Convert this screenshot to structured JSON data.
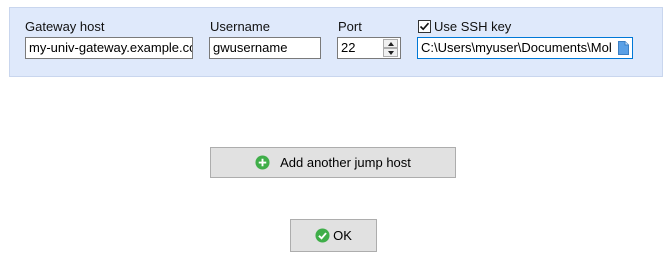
{
  "gateway": {
    "host_label": "Gateway host",
    "host_value": "my-univ-gateway.example.co",
    "username_label": "Username",
    "username_value": "gwusername",
    "port_label": "Port",
    "port_value": "22",
    "ssh_key_label": "Use SSH key",
    "ssh_key_checked": true,
    "ssh_key_path": "C:\\Users\\myuser\\Documents\\Mol"
  },
  "actions": {
    "add_jump_host_label": "Add another jump host",
    "ok_label": "OK"
  },
  "icons": {
    "add": "plus-circle-icon",
    "ok": "check-circle-icon",
    "file": "document-icon"
  },
  "colors": {
    "panel_bg": "#dfe9fb",
    "button_bg": "#e1e1e1",
    "icon_green": "#3fae49",
    "focus_border": "#0078d7"
  }
}
